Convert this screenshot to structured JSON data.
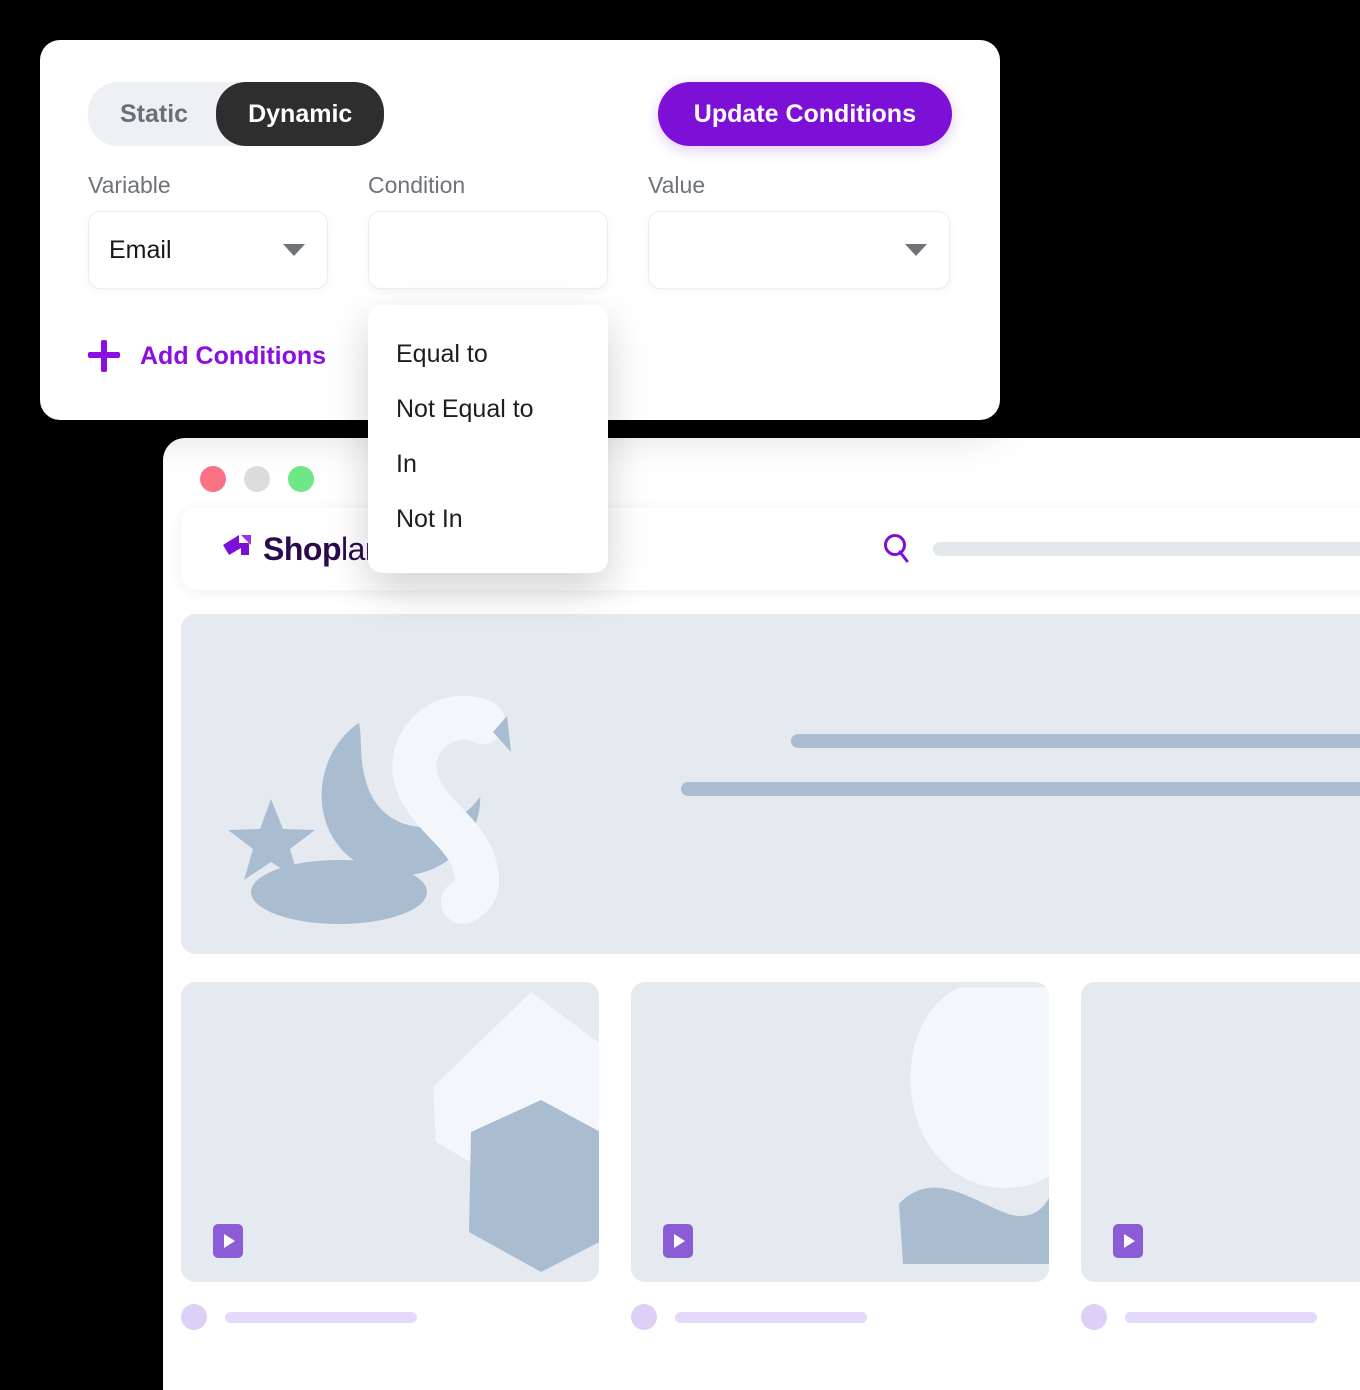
{
  "conditions_panel": {
    "mode_toggle": {
      "static_label": "Static",
      "dynamic_label": "Dynamic",
      "selected": "Dynamic"
    },
    "update_button_label": "Update Conditions",
    "fields": [
      {
        "label": "Variable",
        "value": "Email",
        "has_caret": true
      },
      {
        "label": "Condition",
        "value": "",
        "has_caret": false
      },
      {
        "label": "Value",
        "value": "",
        "has_caret": true
      }
    ],
    "add_conditions_label": "Add Conditions",
    "add_icon": "plus-icon",
    "accent_color": "#7d10d6",
    "link_color": "#8b0fe0",
    "active_pill_color": "#2e2e2e"
  },
  "condition_dropdown": {
    "options": [
      "Equal to",
      "Not Equal to",
      "In",
      "Not In"
    ]
  },
  "browser_window": {
    "traffic_lights": [
      "close-red",
      "minimize-grey",
      "maximize-green"
    ],
    "brand": {
      "mark_icon": "shoplane-arrow-icon",
      "name_bold": "Shop",
      "name_light": "lane",
      "color": "#2b0a4d",
      "mark_color": "#7d10d6"
    },
    "search": {
      "icon": "search-icon",
      "icon_color": "#7d10d6",
      "placeholder_bar_color": "#e4e7ec"
    },
    "hero_banner": {
      "art_icon": "moon-star-placeholder-icon",
      "background": "#e5eaf1",
      "skeleton_line_color": "#a9bcd0",
      "skeleton_lines": 2
    },
    "product_cards": [
      {
        "play_icon": "play-icon",
        "art_icon": "hexagon-placeholder-icon"
      },
      {
        "play_icon": "play-icon",
        "art_icon": "crescent-placeholder-icon"
      },
      {
        "play_icon": "play-icon",
        "art_icon": "blank-placeholder-icon"
      }
    ],
    "card_meta": {
      "avatar_color": "#ddd0f7",
      "bar_color": "#e4d9fa"
    },
    "play_button_color": "#8b5cd6"
  }
}
